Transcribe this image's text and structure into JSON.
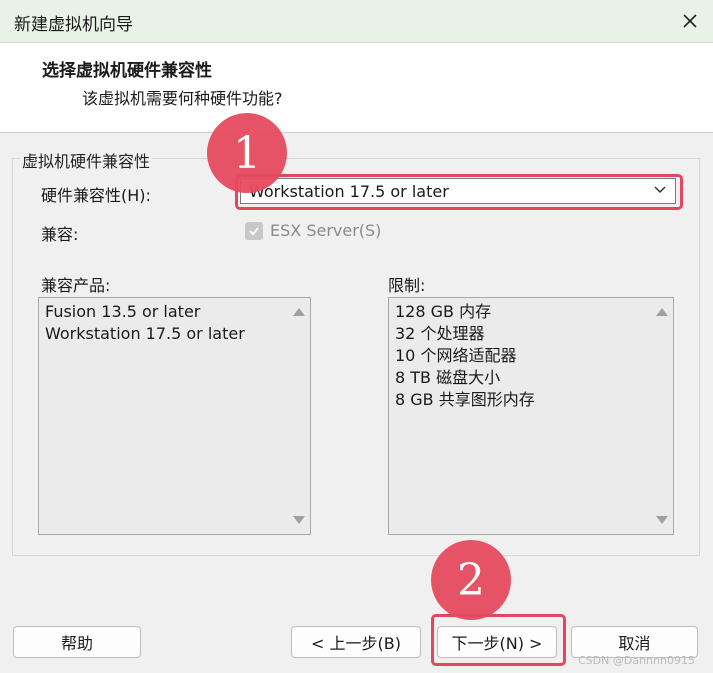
{
  "window": {
    "title": "新建虚拟机向导"
  },
  "header": {
    "title": "选择虚拟机硬件兼容性",
    "subtitle": "该虚拟机需要何种硬件功能?"
  },
  "group": {
    "legend": "虚拟机硬件兼容性",
    "hw_label": "硬件兼容性(H):",
    "hw_value": "Workstation 17.5 or later",
    "compat_label": "兼容:",
    "esx_label": "ESX Server(S)",
    "esx_checked": true,
    "products_label": "兼容产品:",
    "products": [
      "Fusion 13.5 or later",
      "Workstation 17.5 or later"
    ],
    "limits_label": "限制:",
    "limits": [
      "128 GB 内存",
      "32 个处理器",
      "10 个网络适配器",
      "8 TB 磁盘大小",
      "8 GB 共享图形内存"
    ]
  },
  "annotations": {
    "badge1": "1",
    "badge2": "2",
    "accent": "#e74b5f"
  },
  "buttons": {
    "help": "帮助",
    "back": "< 上一步(B)",
    "next": "下一步(N) >",
    "cancel": "取消"
  },
  "watermark": "CSDN @Dannnn0915"
}
